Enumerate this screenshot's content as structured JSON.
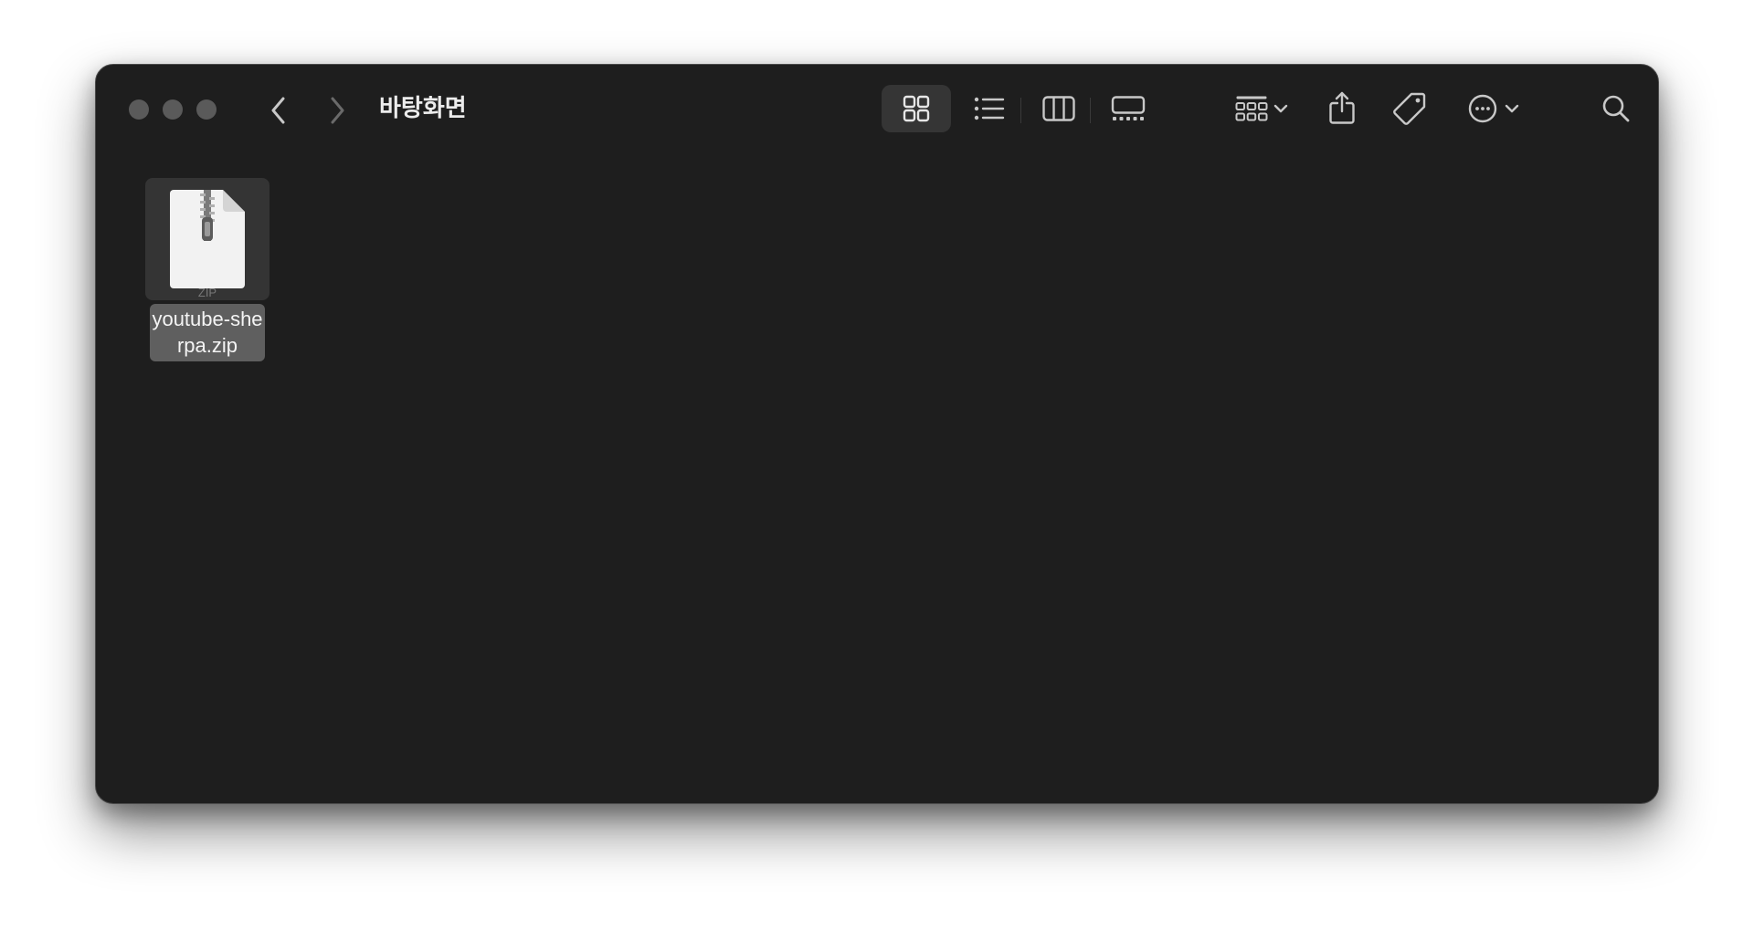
{
  "window": {
    "title": "바탕화면"
  },
  "toolbar": {
    "icons": {
      "close": "close-traffic-light",
      "minimize": "minimize-traffic-light",
      "zoom": "zoom-traffic-light",
      "back": "chevron-left-icon",
      "forward": "chevron-right-icon",
      "icon_view": "grid-view-icon",
      "list_view": "list-view-icon",
      "column_view": "column-view-icon",
      "gallery_view": "gallery-view-icon",
      "group": "group-grid-icon",
      "share": "share-icon",
      "tag": "tag-icon",
      "more": "ellipsis-circle-icon",
      "search": "search-icon"
    },
    "active_view": "icon_view"
  },
  "files": [
    {
      "name": "youtube-sherpa.zip",
      "badge": "ZIP",
      "selected": true
    }
  ],
  "colors": {
    "window_bg": "#1e1e1e",
    "traffic_light": "#5a5a5a",
    "selection_thumb": "#343434",
    "selection_label": "#5f5f5f"
  }
}
